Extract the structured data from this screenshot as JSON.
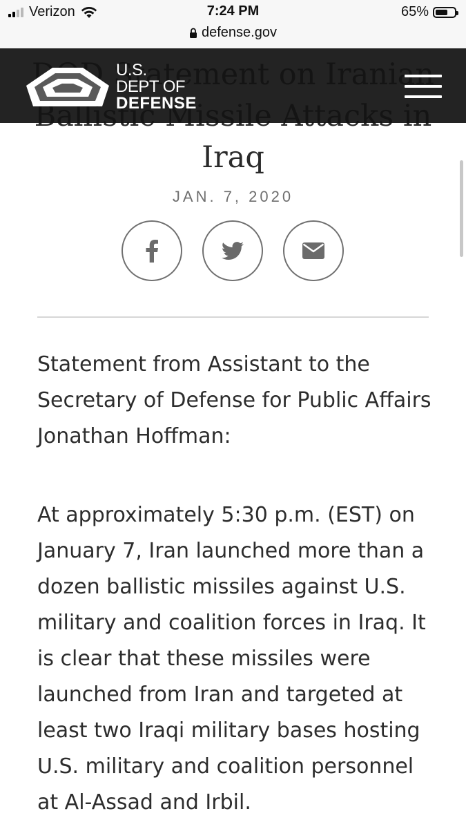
{
  "status_bar": {
    "carrier": "Verizon",
    "time": "7:24 PM",
    "battery_percent": "65%",
    "battery_level": 0.65,
    "url": "defense.gov"
  },
  "header": {
    "logo_line1": "U.S.",
    "logo_line2": "DEPT OF",
    "logo_line3": "DEFENSE",
    "menu_icon": "hamburger-menu-icon"
  },
  "article": {
    "title": "DOD Statement on Iranian Ballistic Missile Attacks in Iraq",
    "date": "JAN. 7, 2020",
    "share": [
      {
        "name": "facebook",
        "icon": "facebook-icon"
      },
      {
        "name": "twitter",
        "icon": "twitter-icon"
      },
      {
        "name": "email",
        "icon": "email-icon"
      }
    ],
    "paragraphs": [
      "Statement from Assistant to the Secretary of Defense for Public Affairs Jonathan Hoffman:",
      "At approximately 5:30 p.m. (EST) on January 7, Iran launched more than a dozen ballistic missiles against U.S. military and coalition forces in Iraq. It is clear that these missiles were launched from Iran and targeted at least two Iraqi military bases hosting U.S. military and coalition personnel at Al-Assad and Irbil."
    ]
  },
  "colors": {
    "header_bg": "#121212",
    "text": "#2d2d2d",
    "muted": "#6f6f6f"
  }
}
